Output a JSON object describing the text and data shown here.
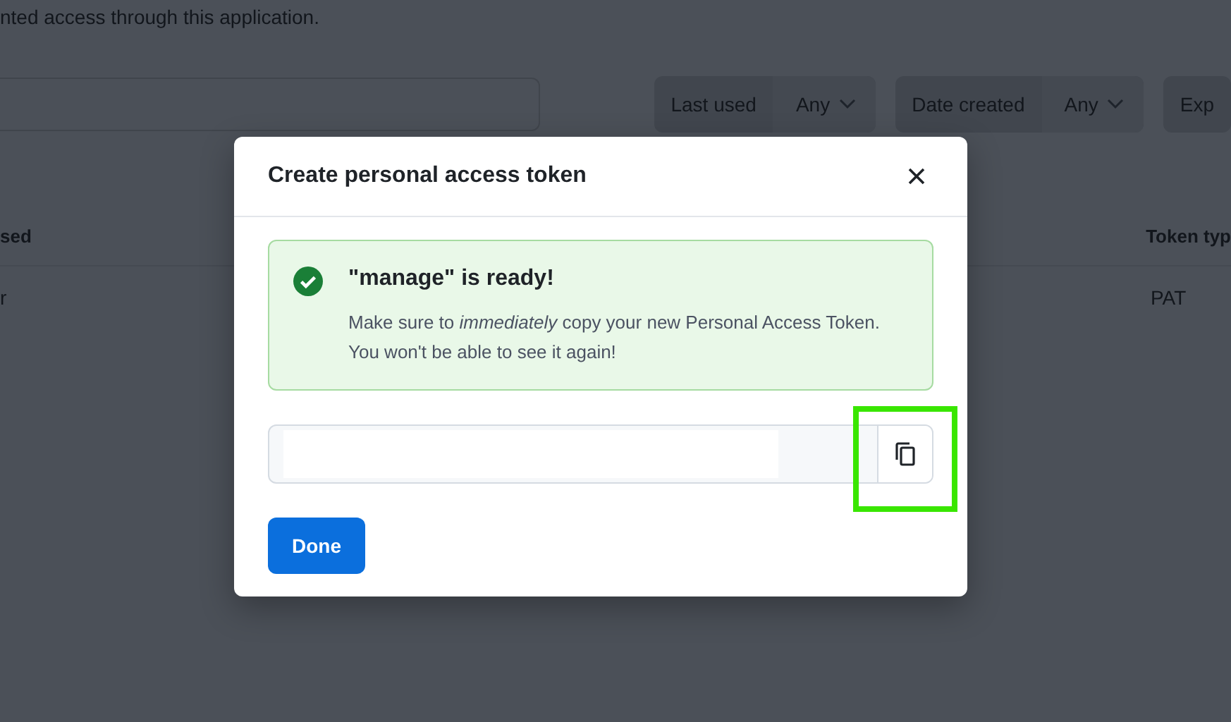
{
  "background_page": {
    "description": "nted access through this application.",
    "filters": [
      {
        "label": "Last used",
        "value": "Any"
      },
      {
        "label": "Date created",
        "value": "Any"
      },
      {
        "label": "Exp"
      }
    ],
    "table": {
      "columns": [
        "sed",
        "Token typ"
      ],
      "rows": [
        [
          "r",
          "PAT"
        ]
      ]
    }
  },
  "dialog": {
    "title": "Create personal access token",
    "alert": {
      "title": "\"manage\" is ready!",
      "message": "Make sure to *immediately* copy your new Personal Access Token.",
      "message_2": "You won't be able to see it again!"
    },
    "token_field": {
      "copy_highlighted": true
    },
    "buttons": [
      "Done"
    ]
  }
}
